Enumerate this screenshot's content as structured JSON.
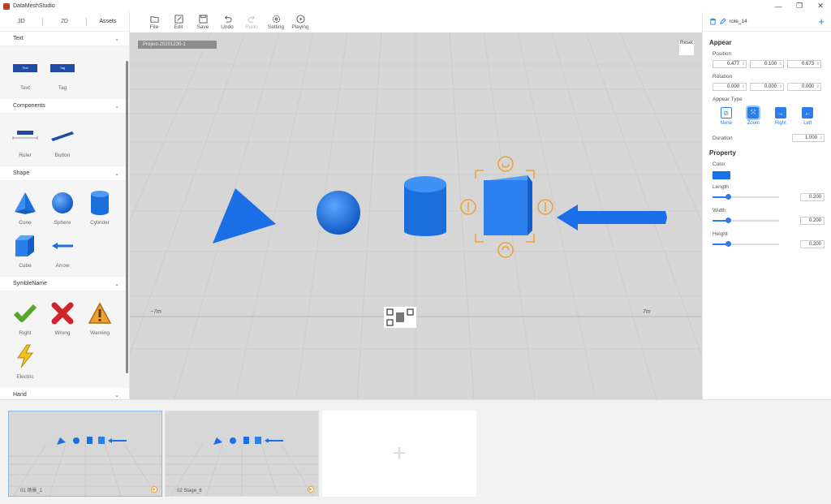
{
  "window": {
    "title": "DataMeshStudio",
    "minimize": "—",
    "restore": "❐",
    "close": "✕"
  },
  "left_tabs": [
    "3D",
    "2D",
    "Assets"
  ],
  "sections": [
    {
      "title": "Text",
      "items": [
        {
          "label": "Text",
          "icon": "text-plate-icon",
          "tag": "Text"
        },
        {
          "label": "Tag",
          "icon": "tag-plate-icon",
          "tag": "Tag"
        }
      ]
    },
    {
      "title": "Components",
      "items": [
        {
          "label": "Ruler",
          "icon": "ruler-icon"
        },
        {
          "label": "Button",
          "icon": "button-plate-icon"
        }
      ]
    },
    {
      "title": "Shape",
      "items": [
        {
          "label": "Cone",
          "icon": "cone-icon"
        },
        {
          "label": "Sphere",
          "icon": "sphere-icon"
        },
        {
          "label": "Cylinder",
          "icon": "cylinder-icon"
        },
        {
          "label": "Cube",
          "icon": "cube-icon"
        },
        {
          "label": "Arrow",
          "icon": "arrow-icon"
        }
      ]
    },
    {
      "title": "SymbleName",
      "items": [
        {
          "label": "Right",
          "icon": "checkmark-icon"
        },
        {
          "label": "Wrong",
          "icon": "cross-icon"
        },
        {
          "label": "Warning",
          "icon": "warning-icon"
        },
        {
          "label": "Electric",
          "icon": "lightning-icon"
        }
      ]
    },
    {
      "title": "Hand",
      "items": []
    }
  ],
  "toolbar": [
    "File",
    "Edit",
    "Save",
    "Undo",
    "Redo",
    "Setting",
    "Playing"
  ],
  "viewport": {
    "project": "Project-20201230-1",
    "reset": "Reset",
    "left_marker": "−7m",
    "right_marker": "7m"
  },
  "inspector": {
    "role": "role_14",
    "appear_heading": "Appear",
    "position_label": "Position",
    "position": [
      "0.477",
      "0.100",
      "0.673"
    ],
    "rotation_label": "Rotation",
    "rotation": [
      "0.000",
      "0.000",
      "0.000"
    ],
    "appear_type_label": "Appear Type",
    "appear_types": [
      "None",
      "Zoom",
      "Right",
      "Left"
    ],
    "duration_label": "Duration",
    "duration": "1.000",
    "property_heading": "Property",
    "color_label": "Color",
    "color": "#1a73e8",
    "length_label": "Length",
    "length": "0.200",
    "width_label": "Width",
    "width": "0.200",
    "height_label": "Height",
    "height": "0.200"
  },
  "scenes": [
    {
      "name": "01 场景_1"
    },
    {
      "name": "02 Stage_6"
    }
  ],
  "add_scene": "+"
}
